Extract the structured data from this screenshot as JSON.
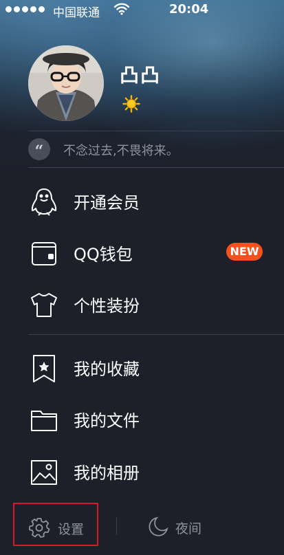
{
  "status_bar": {
    "carrier": "中国联通",
    "time": "20:04"
  },
  "profile": {
    "username": "凸凸",
    "level_icon": "sun-icon",
    "signature": "不念过去,不畏将来。"
  },
  "menu": {
    "group1": [
      {
        "label": "开通会员",
        "icon": "penguin-icon"
      },
      {
        "label": "QQ钱包",
        "icon": "wallet-icon",
        "badge": "NEW"
      },
      {
        "label": "个性装扮",
        "icon": "tshirt-icon"
      }
    ],
    "group2": [
      {
        "label": "我的收藏",
        "icon": "bookmark-star-icon"
      },
      {
        "label": "我的文件",
        "icon": "folder-icon"
      },
      {
        "label": "我的相册",
        "icon": "image-icon"
      }
    ]
  },
  "bottom": {
    "settings_label": "设置",
    "night_label": "夜间"
  },
  "colors": {
    "background": "#1d2029",
    "badge": "#f4511e",
    "highlight_border": "#d8192b",
    "muted_text": "#8e939d"
  }
}
